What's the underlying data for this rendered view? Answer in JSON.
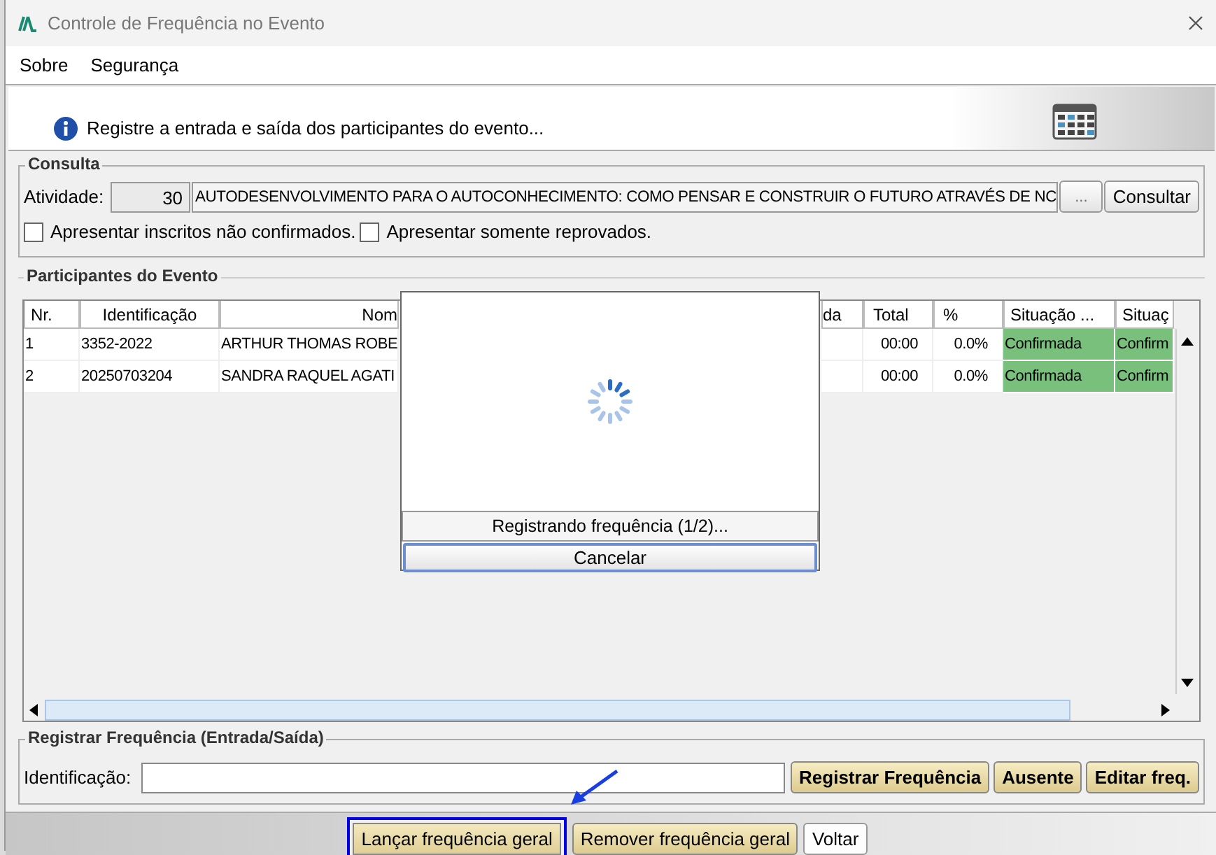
{
  "window": {
    "title": "Controle de Frequência no Evento"
  },
  "menu": [
    "Sobre",
    "Segurança"
  ],
  "banner": {
    "message": "Registre a entrada e saída dos participantes do evento..."
  },
  "consulta": {
    "title": "Consulta",
    "label": "Atividade:",
    "code": "30",
    "activity": "AUTODESENVOLVIMENTO PARA O AUTOCONHECIMENTO: COMO PENSAR E CONSTRUIR O FUTURO ATRAVÉS DE NC",
    "browse": "...",
    "button": "Consultar",
    "options": [
      {
        "label": "Apresentar inscritos não confirmados.",
        "checked": false
      },
      {
        "label": "Apresentar somente reprovados.",
        "checked": false
      }
    ]
  },
  "participants": {
    "title": "Participantes do Evento",
    "columns": [
      {
        "label": "Nr.",
        "kind": "text"
      },
      {
        "label": "Identificação",
        "kind": "text"
      },
      {
        "label": "Nom",
        "kind": "text"
      },
      {
        "kind": "hidden"
      },
      {
        "label": "da",
        "kind": "text"
      },
      {
        "label": "Total",
        "kind": "num"
      },
      {
        "label": "%",
        "kind": "num"
      },
      {
        "label": "Situação ...",
        "kind": "status"
      },
      {
        "label": "Situaç",
        "kind": "status"
      }
    ],
    "rows": [
      [
        "1",
        "3352-2022",
        "ARTHUR THOMAS ROBE",
        "",
        "",
        "00:00",
        "0.0%",
        "Confirmada",
        "Confirm"
      ],
      [
        "2",
        "20250703204",
        "SANDRA RAQUEL AGATI",
        "",
        "",
        "00:00",
        "0.0%",
        "Confirmada",
        "Confirm"
      ]
    ]
  },
  "progress": {
    "message": "Registrando frequência (1/2)...",
    "cancel": "Cancelar"
  },
  "register": {
    "title": "Registrar Frequência (Entrada/Saída)",
    "label": "Identificação:",
    "buttons": [
      "Registrar Frequência",
      "Ausente",
      "Editar freq."
    ]
  },
  "footer": [
    {
      "label": "Lançar frequência geral",
      "highlighted": true
    },
    {
      "label": "Remover frequência geral",
      "highlighted": false
    },
    {
      "label": "Voltar",
      "highlighted": false
    }
  ]
}
